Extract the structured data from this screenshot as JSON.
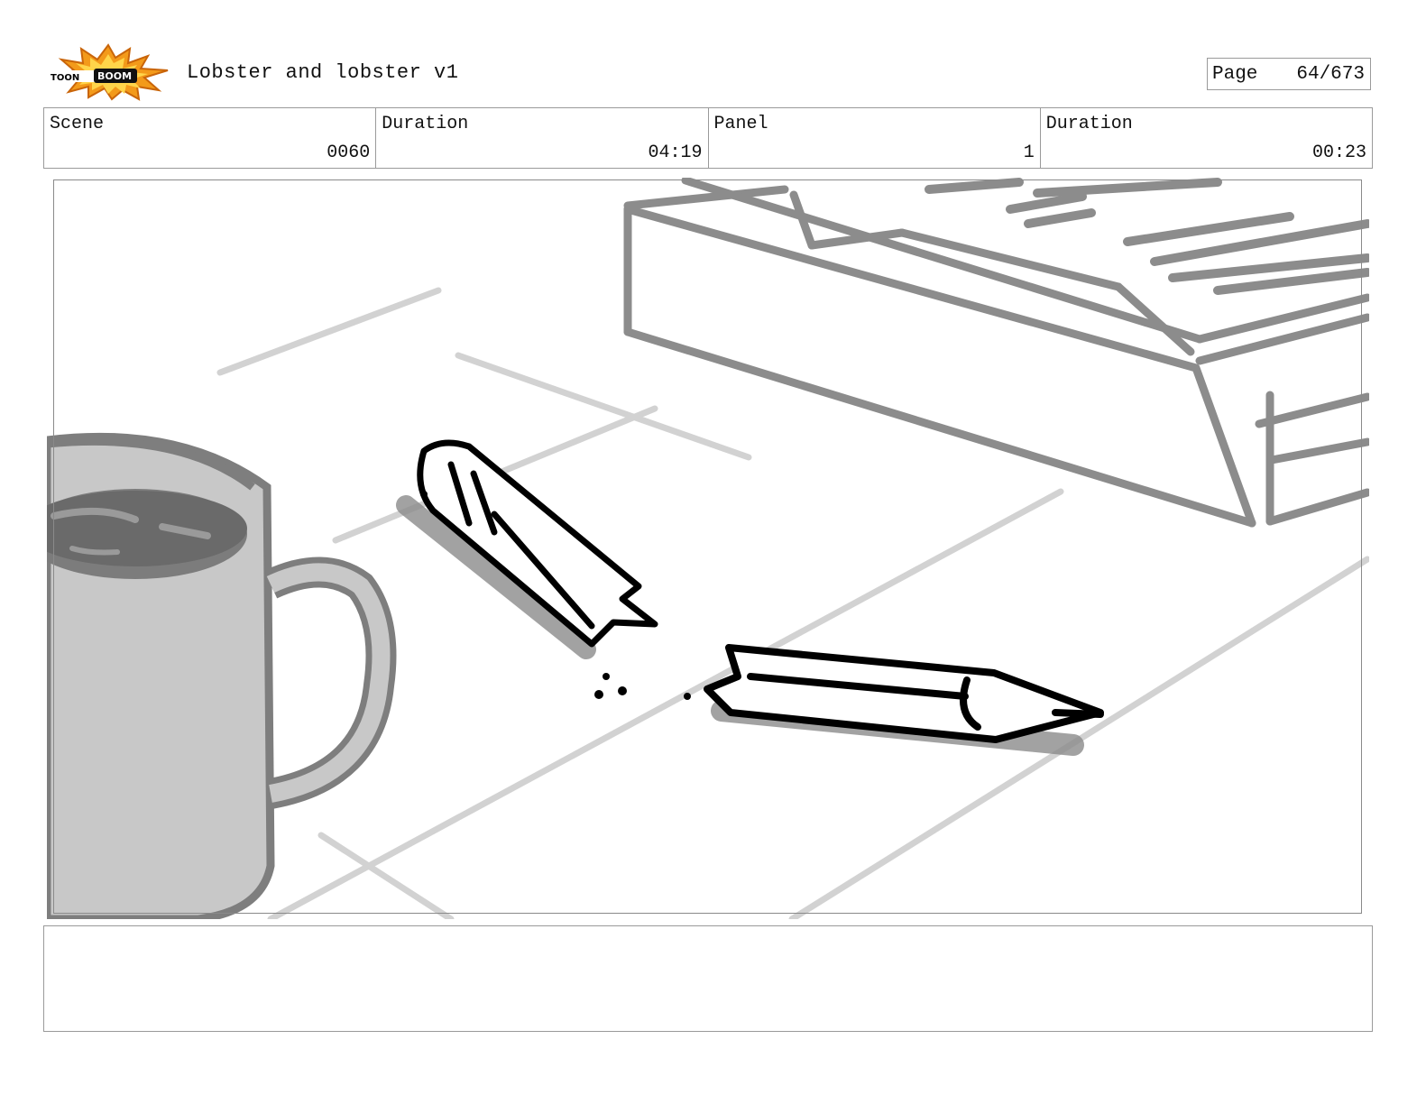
{
  "header": {
    "logo_name": "toonboom-logo",
    "logo_text": "TOON BOOM",
    "title": "Lobster and lobster v1",
    "page_label": "Page",
    "page_value": "64/673"
  },
  "info": {
    "scene_label": "Scene",
    "scene_value": "0060",
    "scene_duration_label": "Duration",
    "scene_duration_value": "04:19",
    "panel_label": "Panel",
    "panel_value": "1",
    "panel_duration_label": "Duration",
    "panel_duration_value": "00:23"
  },
  "panel_image": {
    "subject": "coffee mug, broken pencil, book on desk",
    "colors": {
      "sketch_gray": "#8c8c8c",
      "light_gray": "#d2d2d2",
      "mug_fill": "#c6c6c6",
      "ink": "#000000"
    }
  },
  "notes": {
    "text": ""
  }
}
